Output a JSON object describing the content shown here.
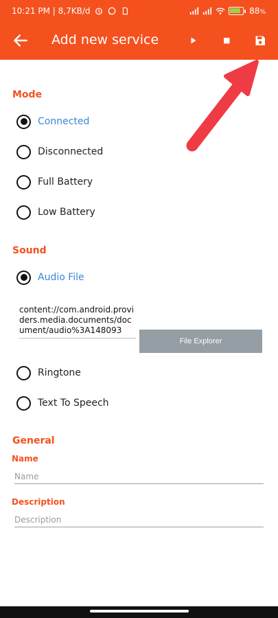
{
  "status_bar": {
    "left_text": "10:21 PM | 8,7KB/d",
    "battery": "88",
    "battery_unit": "%",
    "battery_level": 0.88,
    "icons": [
      "alarm-icon",
      "whatsapp-icon",
      "sim-icon",
      "signal-icon",
      "signal-icon",
      "wifi-icon",
      "battery-icon"
    ]
  },
  "app_bar": {
    "title": "Add new service",
    "actions": [
      "play-icon",
      "stop-icon",
      "save-icon"
    ],
    "color": "#f4511e"
  },
  "mode": {
    "heading": "Mode",
    "options": [
      {
        "label": "Connected",
        "selected": true
      },
      {
        "label": "Disconnected",
        "selected": false
      },
      {
        "label": "Full Battery",
        "selected": false
      },
      {
        "label": "Low Battery",
        "selected": false
      }
    ]
  },
  "sound": {
    "heading": "Sound",
    "options": [
      {
        "label": "Audio File",
        "selected": true
      },
      {
        "label": "Ringtone",
        "selected": false
      },
      {
        "label": "Text To Speech",
        "selected": false
      }
    ],
    "audio_path": "content://com.android.providers.media.documents/document/audio%3A148093",
    "file_explorer_label": "File Explorer"
  },
  "general": {
    "heading": "General",
    "name_label": "Name",
    "name_placeholder": "Name",
    "description_label": "Description",
    "description_placeholder": "Description"
  },
  "colors": {
    "accent": "#f4511e",
    "selected_text": "#3d85d6",
    "button_gray": "#949ea4"
  }
}
